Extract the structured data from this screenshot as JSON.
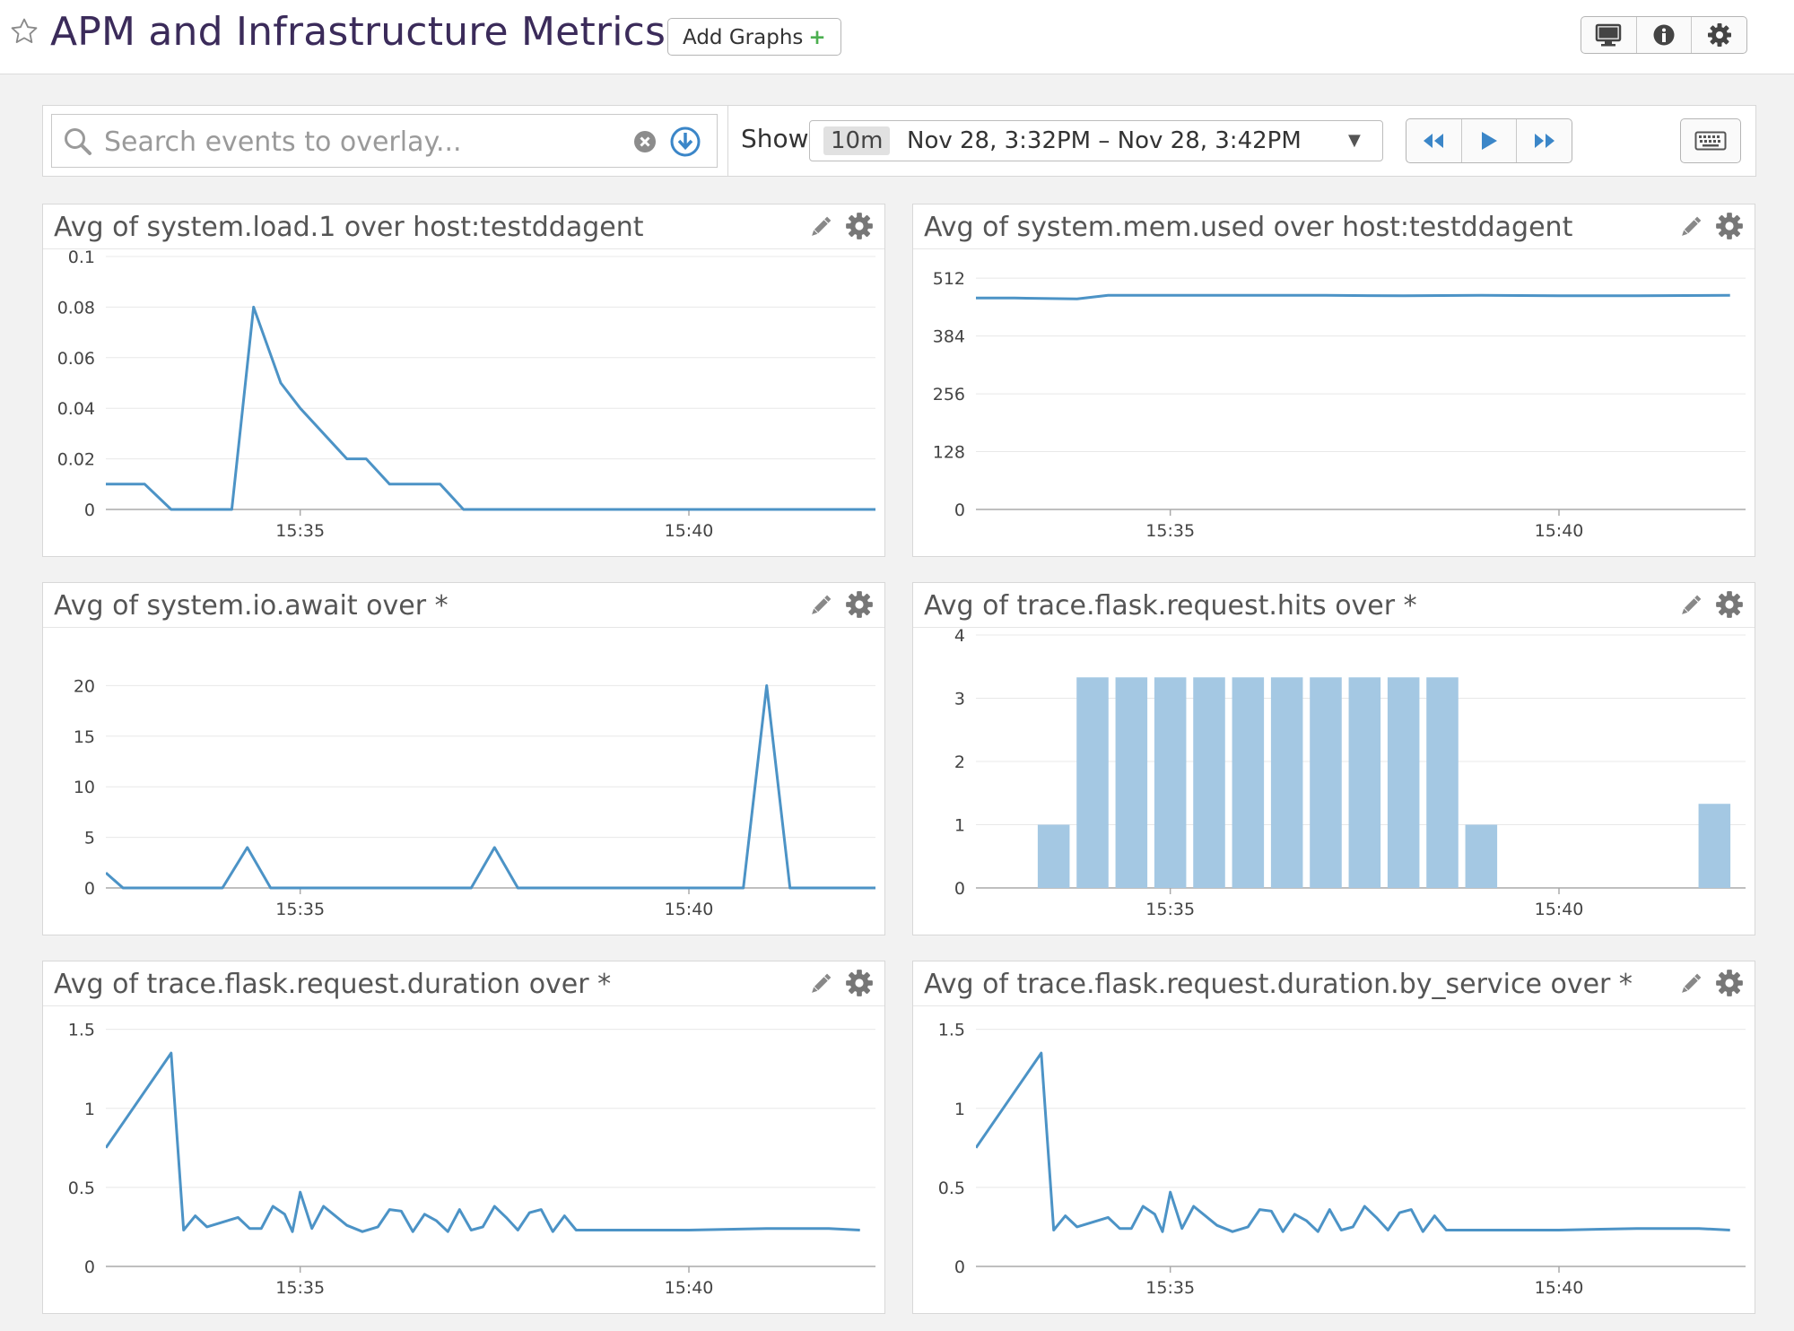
{
  "header": {
    "title": "APM and Infrastructure Metrics",
    "add_graphs_label": "Add Graphs",
    "add_graphs_plus": "+",
    "buttons": [
      "monitor-icon",
      "info-icon",
      "gear-icon"
    ]
  },
  "search": {
    "placeholder": "Search events to overlay..."
  },
  "timeframe": {
    "show_label": "Show",
    "badge": "10m",
    "range": "Nov 28, 3:32PM – Nov 28, 3:42PM"
  },
  "colors": {
    "line": "#4c93c6",
    "bar": "#a4c8e3",
    "title": "#3b2b5a",
    "grid": "#e8e8e8"
  },
  "widgets": [
    {
      "title": "Avg of system.load.1 over host:testddagent"
    },
    {
      "title": "Avg of system.mem.used over host:testddagent"
    },
    {
      "title": "Avg of system.io.await over *"
    },
    {
      "title": "Avg of trace.flask.request.hits over *"
    },
    {
      "title": "Avg of trace.flask.request.duration over *"
    },
    {
      "title": "Avg of trace.flask.request.duration.by_service over *"
    }
  ],
  "chart_data": [
    {
      "type": "line",
      "title": "Avg of system.load.1 over host:testddagent",
      "x_ticks": [
        "15:35",
        "15:40"
      ],
      "y_ticks": [
        "0",
        "0.02",
        "0.04",
        "0.06",
        "0.08",
        "0.1"
      ],
      "ylim": [
        0,
        0.1
      ],
      "xlim": [
        15.5,
        25.4
      ],
      "x_tick_values": [
        18,
        23
      ],
      "series": [
        {
          "x": [
            15.5,
            16.0,
            16.34,
            17.12,
            17.4,
            17.75,
            18.0,
            18.6,
            18.85,
            19.15,
            19.8,
            20.1,
            26.0
          ],
          "y": [
            0.01,
            0.01,
            0,
            0,
            0.08,
            0.05,
            0.04,
            0.02,
            0.02,
            0.01,
            0.01,
            0,
            0
          ]
        }
      ]
    },
    {
      "type": "line",
      "title": "Avg of system.mem.used over host:testddagent",
      "x_ticks": [
        "15:35",
        "15:40"
      ],
      "y_ticks": [
        "0",
        "128",
        "256",
        "384",
        "512"
      ],
      "ylim": [
        0,
        560
      ],
      "xlim": [
        15.5,
        25.4
      ],
      "x_tick_values": [
        18,
        23
      ],
      "series": [
        {
          "x": [
            15.5,
            16.0,
            16.8,
            17.2,
            18.0,
            19.0,
            20.0,
            21.0,
            22.0,
            23.0,
            24.0,
            25.2
          ],
          "y": [
            468,
            468,
            466,
            474,
            474,
            474,
            474,
            473,
            474,
            473,
            473,
            474
          ]
        }
      ]
    },
    {
      "type": "line",
      "title": "Avg of system.io.await over *",
      "x_ticks": [
        "15:35",
        "15:40"
      ],
      "y_ticks": [
        "0",
        "5",
        "10",
        "15",
        "20"
      ],
      "ylim": [
        0,
        25
      ],
      "xlim": [
        15.5,
        25.4
      ],
      "x_tick_values": [
        18,
        23
      ],
      "series": [
        {
          "x": [
            15.5,
            15.72,
            17.0,
            17.32,
            17.62,
            20.2,
            20.5,
            20.8,
            23.7,
            24.0,
            24.3,
            26.0
          ],
          "y": [
            1.5,
            0,
            0,
            4,
            0,
            0,
            4,
            0,
            0,
            20,
            0,
            0
          ]
        }
      ]
    },
    {
      "type": "bar",
      "title": "Avg of trace.flask.request.hits over *",
      "x_ticks": [
        "15:35",
        "15:40"
      ],
      "y_ticks": [
        "0",
        "1",
        "2",
        "3",
        "4"
      ],
      "ylim": [
        0,
        4
      ],
      "xlim": [
        15.5,
        25.4
      ],
      "x_tick_values": [
        18,
        23
      ],
      "bar_x": [
        16.5,
        17.0,
        17.5,
        18.0,
        18.5,
        19.0,
        19.5,
        20.0,
        20.5,
        21.0,
        21.5,
        22.0,
        25.0
      ],
      "values": [
        1,
        3.33,
        3.33,
        3.33,
        3.33,
        3.33,
        3.33,
        3.33,
        3.33,
        3.33,
        3.33,
        1,
        1.33
      ]
    },
    {
      "type": "line",
      "title": "Avg of trace.flask.request.duration over *",
      "x_ticks": [
        "15:35",
        "15:40"
      ],
      "y_ticks": [
        "0",
        "0.5",
        "1",
        "1.5"
      ],
      "ylim": [
        0,
        1.6
      ],
      "xlim": [
        15.5,
        25.4
      ],
      "x_tick_values": [
        18,
        23
      ],
      "series": [
        {
          "x": [
            15.5,
            16.34,
            16.5,
            16.65,
            16.8,
            17.0,
            17.2,
            17.35,
            17.5,
            17.65,
            17.8,
            17.9,
            18.0,
            18.15,
            18.3,
            18.45,
            18.6,
            18.8,
            19.0,
            19.15,
            19.3,
            19.45,
            19.6,
            19.75,
            19.9,
            20.05,
            20.2,
            20.35,
            20.5,
            20.65,
            20.8,
            20.95,
            21.1,
            21.25,
            21.4,
            21.55,
            21.7,
            21.85,
            22.0,
            22.2,
            22.4,
            23.0,
            24.0,
            24.8,
            25.2
          ],
          "y": [
            0.75,
            1.35,
            0.23,
            0.32,
            0.25,
            0.28,
            0.31,
            0.24,
            0.24,
            0.38,
            0.33,
            0.22,
            0.47,
            0.24,
            0.38,
            0.32,
            0.26,
            0.22,
            0.25,
            0.36,
            0.35,
            0.22,
            0.33,
            0.29,
            0.22,
            0.36,
            0.23,
            0.25,
            0.38,
            0.31,
            0.23,
            0.34,
            0.36,
            0.22,
            0.32,
            0.23,
            0.23,
            0.23,
            0.23,
            0.23,
            0.23,
            0.23,
            0.24,
            0.24,
            0.23
          ]
        }
      ]
    },
    {
      "type": "line",
      "title": "Avg of trace.flask.request.duration.by_service over *",
      "x_ticks": [
        "15:35",
        "15:40"
      ],
      "y_ticks": [
        "0",
        "0.5",
        "1",
        "1.5"
      ],
      "ylim": [
        0,
        1.6
      ],
      "xlim": [
        15.5,
        25.4
      ],
      "x_tick_values": [
        18,
        23
      ],
      "series": [
        {
          "x": [
            15.5,
            16.34,
            16.5,
            16.65,
            16.8,
            17.0,
            17.2,
            17.35,
            17.5,
            17.65,
            17.8,
            17.9,
            18.0,
            18.15,
            18.3,
            18.45,
            18.6,
            18.8,
            19.0,
            19.15,
            19.3,
            19.45,
            19.6,
            19.75,
            19.9,
            20.05,
            20.2,
            20.35,
            20.5,
            20.65,
            20.8,
            20.95,
            21.1,
            21.25,
            21.4,
            21.55,
            21.7,
            21.85,
            22.0,
            22.2,
            22.4,
            23.0,
            24.0,
            24.8,
            25.2
          ],
          "y": [
            0.75,
            1.35,
            0.23,
            0.32,
            0.25,
            0.28,
            0.31,
            0.24,
            0.24,
            0.38,
            0.33,
            0.22,
            0.47,
            0.24,
            0.38,
            0.32,
            0.26,
            0.22,
            0.25,
            0.36,
            0.35,
            0.22,
            0.33,
            0.29,
            0.22,
            0.36,
            0.23,
            0.25,
            0.38,
            0.31,
            0.23,
            0.34,
            0.36,
            0.22,
            0.32,
            0.23,
            0.23,
            0.23,
            0.23,
            0.23,
            0.23,
            0.23,
            0.24,
            0.24,
            0.23
          ]
        }
      ]
    }
  ]
}
